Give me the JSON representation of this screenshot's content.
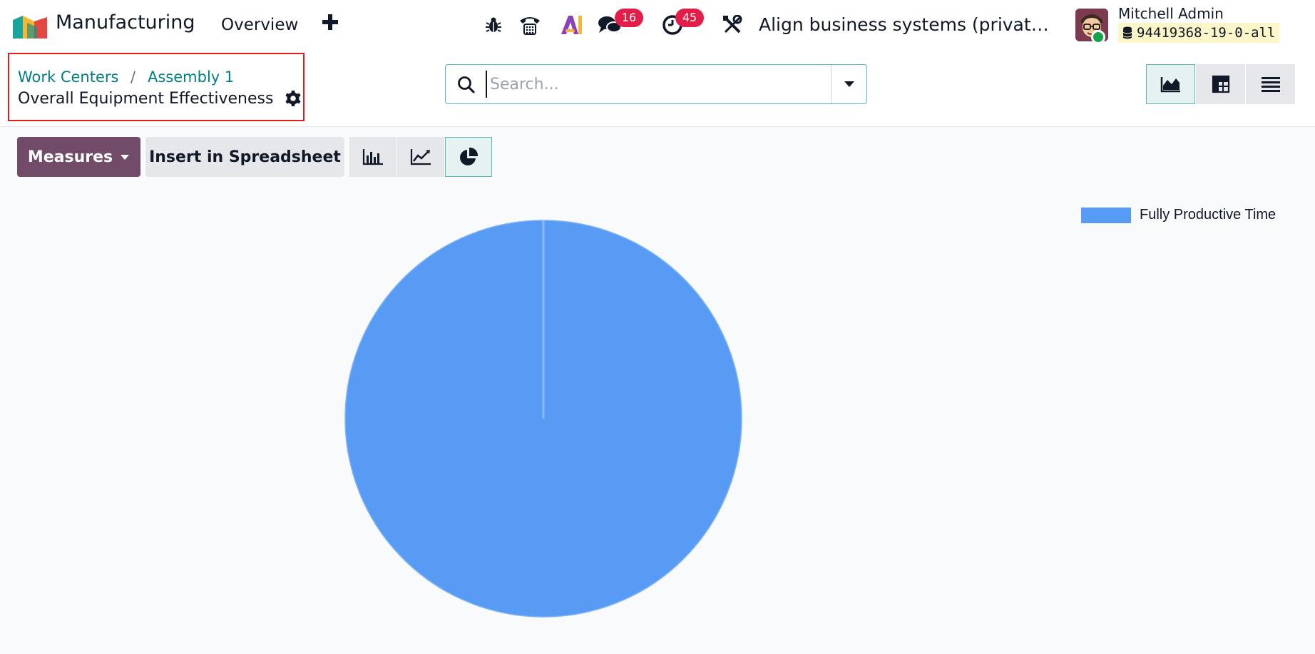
{
  "navbar": {
    "app_name": "Manufacturing",
    "menu_overview": "Overview",
    "chat_count": "16",
    "activity_count": "45",
    "company": "Align business systems (private) lim...",
    "user_name": "Mitchell Admin",
    "database": "94419368-19-0-all",
    "icons": [
      "bug-icon",
      "phone-icon",
      "ai-icon",
      "chat-icon",
      "clock-icon",
      "tools-icon"
    ]
  },
  "breadcrumb": {
    "items": [
      "Work Centers",
      "Assembly 1"
    ],
    "separator": "/",
    "current": "Overall Equipment Effectiveness"
  },
  "search": {
    "placeholder": "Search...",
    "value": ""
  },
  "toolbar": {
    "measures_label": "Measures",
    "insert_label": "Insert in Spreadsheet"
  },
  "colors": {
    "brand": "#714b67",
    "accent": "#017e84",
    "series": "#589bf5",
    "badge": "#e11d48"
  },
  "chart_data": {
    "type": "pie",
    "categories": [
      "Fully Productive Time"
    ],
    "values": [
      100
    ],
    "colors": [
      "#589bf5"
    ],
    "legend": "top-right"
  }
}
